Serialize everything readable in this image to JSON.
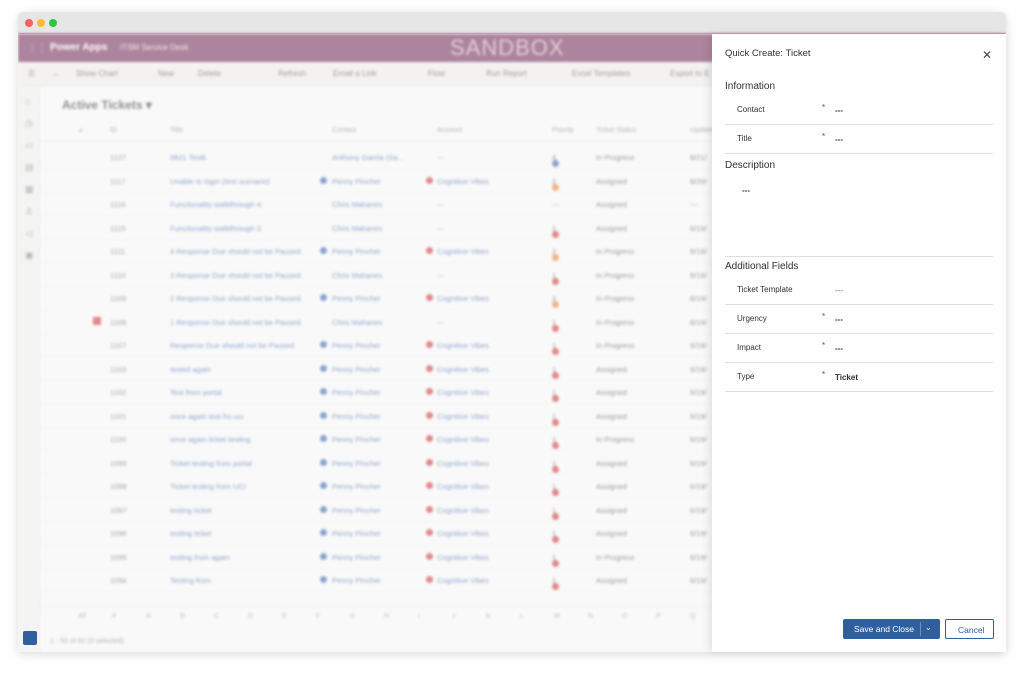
{
  "app": {
    "brand": "Power Apps",
    "app_name": "ITSM Service Desk",
    "environment": "SANDBOX"
  },
  "command_bar": [
    "Show Chart",
    "New",
    "Delete",
    "Refresh",
    "Email a Link",
    "Flow",
    "Run Report",
    "Excel Templates",
    "Export to E"
  ],
  "view": {
    "title": "Active Tickets",
    "columns": [
      "ID",
      "Title",
      "Contact",
      "Account",
      "Priority",
      "Ticket Status",
      "Updated"
    ],
    "rows": [
      {
        "id": "1127",
        "title": "0621 Testk",
        "contact": "Anthony Garcia (Sa...",
        "account": "---",
        "priority": "4",
        "status": "In Progress",
        "date": "6/21/"
      },
      {
        "id": "1117",
        "title": "Unable to login (test scenario)",
        "contact": "Penny Pincher",
        "account": "Cognitive Vibes",
        "priority": "2",
        "status": "Assigned",
        "date": "6/20/"
      },
      {
        "id": "1116",
        "title": "Functionality walkthrough 4",
        "contact": "Chris Mahanes",
        "account": "---",
        "priority": "---",
        "status": "Assigned",
        "date": "---"
      },
      {
        "id": "1115",
        "title": "Functionality walkthrough 3",
        "contact": "Chris Mahanes",
        "account": "---",
        "priority": "1",
        "status": "Assigned",
        "date": "6/19/"
      },
      {
        "id": "1111",
        "title": "4 Response Due should not be Paused.",
        "contact": "Penny Pincher",
        "account": "Cognitive Vibes",
        "priority": "2",
        "status": "In Progress",
        "date": "6/19/"
      },
      {
        "id": "1110",
        "title": "3 Response Due should not be Paused.",
        "contact": "Chris Mahanes",
        "account": "---",
        "priority": "1",
        "status": "In Progress",
        "date": "6/19/"
      },
      {
        "id": "1109",
        "title": "2 Response Due should not be Paused.",
        "contact": "Penny Pincher",
        "account": "Cognitive Vibes",
        "priority": "2",
        "status": "In Progress",
        "date": "6/19/"
      },
      {
        "id": "1108",
        "title": "1 Response Due should not be Paused.",
        "contact": "Chris Mahanes",
        "account": "---",
        "priority": "1",
        "status": "In Progress",
        "date": "6/19/"
      },
      {
        "id": "1107",
        "title": "Response Due should not be Paused",
        "contact": "Penny Pincher",
        "account": "Cognitive Vibes",
        "priority": "1",
        "status": "In Progress",
        "date": "6/19/"
      },
      {
        "id": "1103",
        "title": "tested again",
        "contact": "Penny Pincher",
        "account": "Cognitive Vibes",
        "priority": "1",
        "status": "Assigned",
        "date": "6/19/"
      },
      {
        "id": "1102",
        "title": "Test from portal",
        "contact": "Penny Pincher",
        "account": "Cognitive Vibes",
        "priority": "1",
        "status": "Assigned",
        "date": "6/19/"
      },
      {
        "id": "1101",
        "title": "once again test fro uci",
        "contact": "Penny Pincher",
        "account": "Cognitive Vibes",
        "priority": "1",
        "status": "Assigned",
        "date": "6/19/"
      },
      {
        "id": "1100",
        "title": "once again ticket testing",
        "contact": "Penny Pincher",
        "account": "Cognitive Vibes",
        "priority": "1",
        "status": "In Progress",
        "date": "6/19/"
      },
      {
        "id": "1099",
        "title": "Ticket testing from portal",
        "contact": "Penny Pincher",
        "account": "Cognitive Vibes",
        "priority": "1",
        "status": "Assigned",
        "date": "6/19/"
      },
      {
        "id": "1098",
        "title": "Ticket testing from UCI",
        "contact": "Penny Pincher",
        "account": "Cognitive Vibes",
        "priority": "1",
        "status": "Assigned",
        "date": "6/19/"
      },
      {
        "id": "1097",
        "title": "testing ticket",
        "contact": "Penny Pincher",
        "account": "Cognitive Vibes",
        "priority": "1",
        "status": "Assigned",
        "date": "6/19/"
      },
      {
        "id": "1096",
        "title": "testing ticket",
        "contact": "Penny Pincher",
        "account": "Cognitive Vibes",
        "priority": "1",
        "status": "Assigned",
        "date": "6/19/"
      },
      {
        "id": "1095",
        "title": "testing from again",
        "contact": "Penny Pincher",
        "account": "Cognitive Vibes",
        "priority": "1",
        "status": "In Progress",
        "date": "6/19/"
      },
      {
        "id": "1094",
        "title": "Testing from",
        "contact": "Penny Pincher",
        "account": "Cognitive Vibes",
        "priority": "1",
        "status": "Assigned",
        "date": "6/19/"
      }
    ],
    "jump_letters": [
      "All",
      "#",
      "A",
      "B",
      "C",
      "D",
      "E",
      "F",
      "G",
      "H",
      "I",
      "J",
      "K",
      "L",
      "M",
      "N",
      "O",
      "P",
      "Q"
    ],
    "status_text": "1 - 50 of 82 (0 selected)"
  },
  "quick_create": {
    "title": "Quick Create: Ticket",
    "sections": {
      "information": "Information",
      "description": "Description",
      "additional": "Additional Fields"
    },
    "fields": {
      "contact": {
        "label": "Contact",
        "required": "*",
        "value": "---"
      },
      "title": {
        "label": "Title",
        "required": "*",
        "value": "---"
      },
      "description": {
        "value": "---"
      },
      "ticket_template": {
        "label": "Ticket Template",
        "value": "---"
      },
      "urgency": {
        "label": "Urgency",
        "required": "*",
        "value": "---"
      },
      "impact": {
        "label": "Impact",
        "required": "*",
        "value": "---"
      },
      "type": {
        "label": "Type",
        "required": "*",
        "value": "Ticket"
      }
    },
    "buttons": {
      "save": "Save and Close",
      "cancel": "Cancel"
    }
  },
  "colors": {
    "topbar": "#6b1f4e",
    "primary_button": "#2f5f9f",
    "required_red": "#a4262c",
    "required_blue": "#2b5aa6",
    "priority_high": "#c8262b",
    "priority_medium": "#e8762d",
    "priority_low": "#2b5aa6"
  }
}
